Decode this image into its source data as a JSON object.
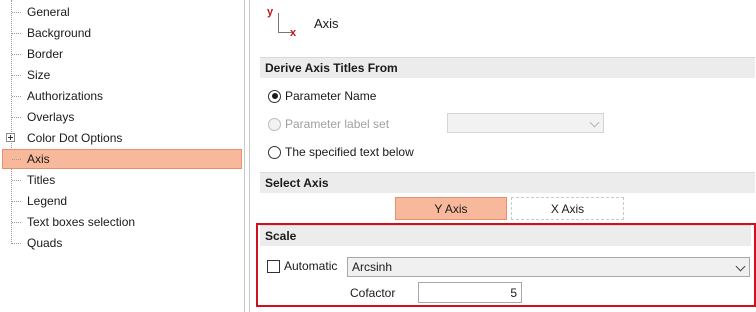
{
  "tree": {
    "items": [
      {
        "label": "General"
      },
      {
        "label": "Background"
      },
      {
        "label": "Border"
      },
      {
        "label": "Size"
      },
      {
        "label": "Authorizations"
      },
      {
        "label": "Overlays"
      },
      {
        "label": "Color Dot Options"
      },
      {
        "label": "Axis"
      },
      {
        "label": "Titles"
      },
      {
        "label": "Legend"
      },
      {
        "label": "Text boxes selection"
      },
      {
        "label": "Quads"
      }
    ],
    "selected": "Axis",
    "expandable": "Color Dot Options"
  },
  "panel": {
    "icon": "axis-icon",
    "icon_y_letter": "y",
    "icon_x_letter": "x",
    "title": "Axis"
  },
  "derive_titles": {
    "header": "Derive Axis Titles From",
    "options": [
      {
        "label": "Parameter Name",
        "checked": true,
        "enabled": true
      },
      {
        "label": "Parameter label set",
        "checked": false,
        "enabled": false
      },
      {
        "label": "The specified text below",
        "checked": false,
        "enabled": true
      }
    ],
    "label_set_value": ""
  },
  "select_axis": {
    "header": "Select Axis",
    "y_label": "Y Axis",
    "x_label": "X Axis",
    "selected": "Y Axis"
  },
  "scale": {
    "header": "Scale",
    "automatic_label": "Automatic",
    "automatic_checked": false,
    "type_value": "Arcsinh",
    "cofactor_label": "Cofactor",
    "cofactor_value": "5"
  },
  "colors": {
    "selection_fill": "#f8b89c",
    "selection_border": "#e88d6e",
    "highlight_box": "#d0101d",
    "icon_letters": "#c0161a"
  }
}
